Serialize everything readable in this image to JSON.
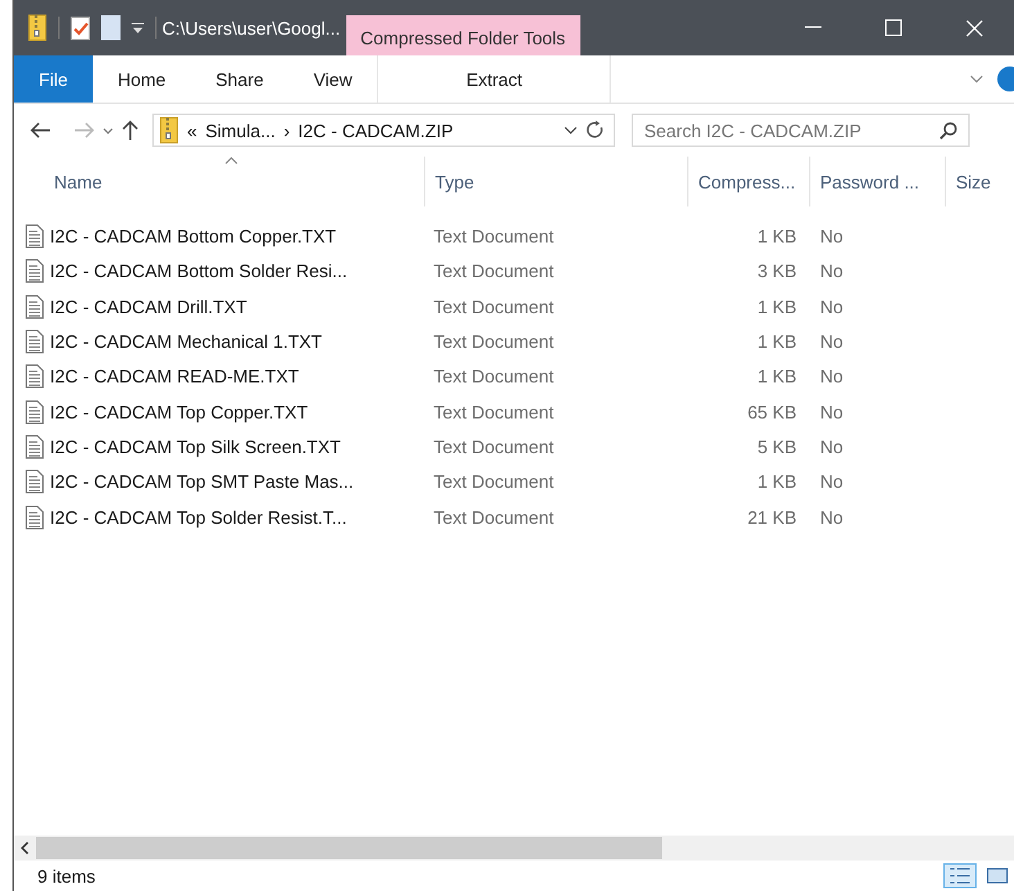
{
  "window": {
    "title": "C:\\Users\\user\\Googl...",
    "context_tab": "Compressed Folder Tools"
  },
  "ribbon_tabs": [
    {
      "label": "File",
      "selected": true
    },
    {
      "label": "Home",
      "selected": false
    },
    {
      "label": "Share",
      "selected": false
    },
    {
      "label": "View",
      "selected": false
    },
    {
      "label": "Extract",
      "selected": false
    }
  ],
  "address": {
    "overflow": "«",
    "crumbs": [
      "Simula...",
      "I2C - CADCAM.ZIP"
    ],
    "separator": "›"
  },
  "search": {
    "placeholder": "Search I2C - CADCAM.ZIP"
  },
  "columns": [
    "Name",
    "Type",
    "Compress...",
    "Password ...",
    "Size"
  ],
  "rows": [
    {
      "name": "I2C - CADCAM Bottom Copper.TXT",
      "type": "Text Document",
      "compressed": "1 KB",
      "password": "No"
    },
    {
      "name": "I2C - CADCAM Bottom Solder Resi...",
      "type": "Text Document",
      "compressed": "3 KB",
      "password": "No"
    },
    {
      "name": "I2C - CADCAM Drill.TXT",
      "type": "Text Document",
      "compressed": "1 KB",
      "password": "No"
    },
    {
      "name": "I2C - CADCAM Mechanical 1.TXT",
      "type": "Text Document",
      "compressed": "1 KB",
      "password": "No"
    },
    {
      "name": "I2C - CADCAM READ-ME.TXT",
      "type": "Text Document",
      "compressed": "1 KB",
      "password": "No"
    },
    {
      "name": "I2C - CADCAM Top Copper.TXT",
      "type": "Text Document",
      "compressed": "65 KB",
      "password": "No"
    },
    {
      "name": "I2C - CADCAM Top Silk Screen.TXT",
      "type": "Text Document",
      "compressed": "5 KB",
      "password": "No"
    },
    {
      "name": "I2C - CADCAM Top SMT Paste Mas...",
      "type": "Text Document",
      "compressed": "1 KB",
      "password": "No"
    },
    {
      "name": "I2C - CADCAM Top Solder Resist.T...",
      "type": "Text Document",
      "compressed": "21 KB",
      "password": "No"
    }
  ],
  "status_bar": {
    "count": "9 items"
  },
  "views": [
    {
      "kind": "details",
      "selected": true
    },
    {
      "kind": "tiles",
      "selected": false
    }
  ]
}
